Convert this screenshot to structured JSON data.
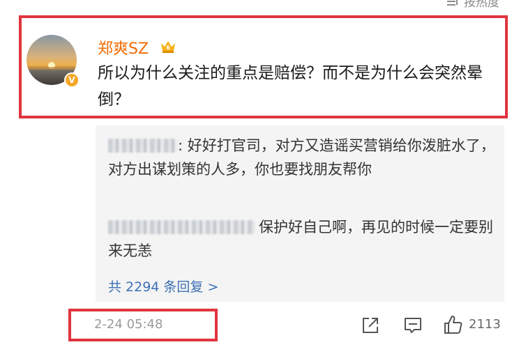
{
  "sort_label": "按热度",
  "comment": {
    "username": "郑爽SZ",
    "text": "所以为什么关注的重点是赔偿？而不是为什么会突然晕倒？"
  },
  "replies": [
    {
      "author_visible": "",
      "text": ": 好好打官司，对方又造谣买营销给你泼脏水了，对方出谋划策的人多，你也要找朋友帮你"
    },
    {
      "author_visible": "",
      "text": "保护好自己啊，再见的时候一定要别来无恙"
    }
  ],
  "more_replies": "共 2294 条回复 >",
  "footer": {
    "timestamp": "2-24 05:48",
    "like_count": "2113"
  },
  "icons": {
    "sort": "sort-icon",
    "avatar": "sunset-avatar",
    "verified": "verified-badge-icon",
    "vip": "vip-crown-icon",
    "share": "share-icon",
    "reply": "comment-icon",
    "like": "thumbs-up-icon"
  },
  "colors": {
    "username": "#f26b00",
    "link": "#3d6fb5",
    "highlight_border": "#e0343f",
    "reply_bg": "#f4f4f4"
  }
}
